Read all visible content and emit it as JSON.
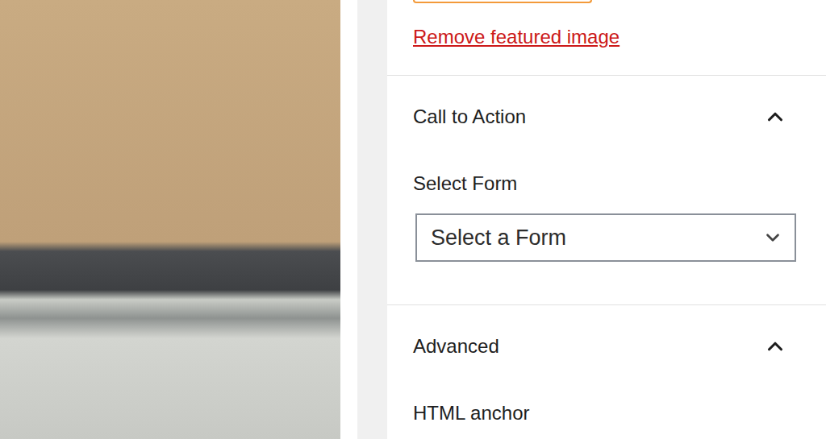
{
  "featured_image": {
    "remove_link": "Remove featured image"
  },
  "panels": [
    {
      "title": "Call to Action",
      "expanded": true,
      "fields": [
        {
          "kind": "select",
          "label": "Select Form",
          "value": "Select a Form"
        }
      ]
    },
    {
      "title": "Advanced",
      "expanded": true,
      "fields": [
        {
          "kind": "text",
          "label": "HTML anchor",
          "value": ""
        }
      ]
    }
  ]
}
